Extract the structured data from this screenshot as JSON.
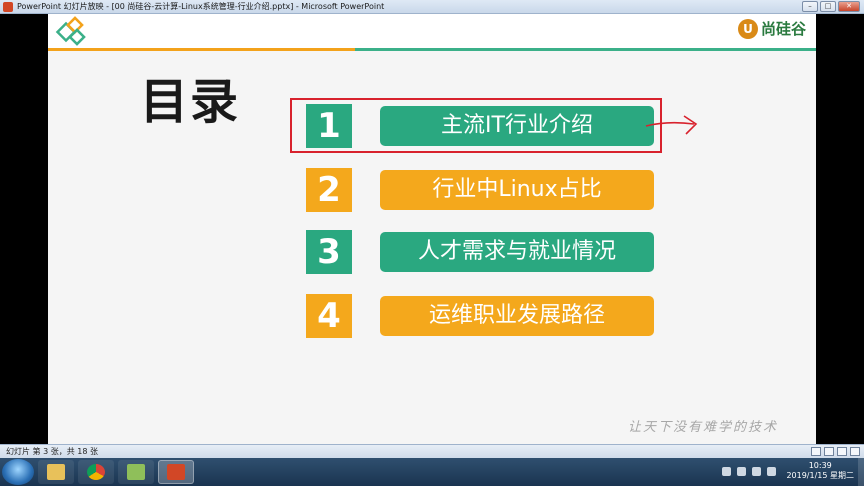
{
  "window": {
    "title": "PowerPoint 幻灯片放映 - [00 尚硅谷-云计算-Linux系统管理-行业介绍.pptx] - Microsoft PowerPoint"
  },
  "slide": {
    "heading": "目录",
    "logo_text": "尚硅谷",
    "logo_mark": "U",
    "items": [
      {
        "number": "1",
        "label": "主流IT行业介绍"
      },
      {
        "number": "2",
        "label": "行业中Linux占比"
      },
      {
        "number": "3",
        "label": "人才需求与就业情况"
      },
      {
        "number": "4",
        "label": "运维职业发展路径"
      }
    ],
    "watermark": "让天下没有难学的技术",
    "colors": {
      "green": "#2aa880",
      "orange": "#f4a81c",
      "annotation_red": "#d8222d"
    }
  },
  "statusbar": {
    "text": "幻灯片 第 3 张，共 18 张"
  },
  "taskbar": {
    "time": "10:39",
    "date": "2019/1/15 星期二"
  }
}
